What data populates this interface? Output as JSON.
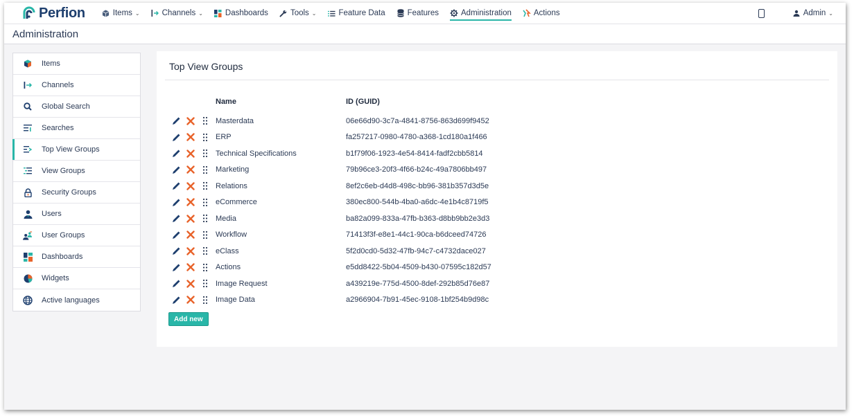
{
  "app": {
    "brand": "Perfion",
    "title": "Administration"
  },
  "nav": {
    "items": [
      {
        "label": "Items",
        "icon": "cube-icon",
        "dropdown": true
      },
      {
        "label": "Channels",
        "icon": "channel-icon",
        "dropdown": true
      },
      {
        "label": "Dashboards",
        "icon": "dashboard-icon",
        "dropdown": false
      },
      {
        "label": "Tools",
        "icon": "wrench-icon",
        "dropdown": true
      },
      {
        "label": "Feature Data",
        "icon": "list-icon",
        "dropdown": false
      },
      {
        "label": "Features",
        "icon": "database-icon",
        "dropdown": false
      },
      {
        "label": "Administration",
        "icon": "gear-icon",
        "dropdown": false,
        "active": true
      },
      {
        "label": "Actions",
        "icon": "actions-icon",
        "dropdown": false
      }
    ],
    "user_label": "Admin"
  },
  "sidebar": {
    "items": [
      {
        "label": "Items",
        "icon": "cube-icon"
      },
      {
        "label": "Channels",
        "icon": "channel-icon"
      },
      {
        "label": "Global Search",
        "icon": "search-icon"
      },
      {
        "label": "Searches",
        "icon": "searches-icon"
      },
      {
        "label": "Top View Groups",
        "icon": "top-view-groups-icon",
        "active": true
      },
      {
        "label": "View Groups",
        "icon": "view-groups-icon"
      },
      {
        "label": "Security Groups",
        "icon": "lock-icon"
      },
      {
        "label": "Users",
        "icon": "user-icon"
      },
      {
        "label": "User Groups",
        "icon": "user-groups-icon"
      },
      {
        "label": "Dashboards",
        "icon": "dashboard-icon"
      },
      {
        "label": "Widgets",
        "icon": "pie-icon"
      },
      {
        "label": "Active languages",
        "icon": "globe-icon"
      }
    ]
  },
  "main": {
    "title": "Top View Groups",
    "columns": {
      "name": "Name",
      "id": "ID (GUID)"
    },
    "rows": [
      {
        "name": "Masterdata",
        "id": "06e66d90-3c7a-4841-8756-863d699f9452"
      },
      {
        "name": "ERP",
        "id": "fa257217-0980-4780-a368-1cd180a1f466"
      },
      {
        "name": "Technical Specifications",
        "id": "b1f79f06-1923-4e54-8414-fadf2cbb5814"
      },
      {
        "name": "Marketing",
        "id": "79b96ce3-20f3-4f66-b24c-49a7806bb497"
      },
      {
        "name": "Relations",
        "id": "8ef2c6eb-d4d8-498c-bb96-381b357d3d5e"
      },
      {
        "name": "eCommerce",
        "id": "380ec800-544b-4ba0-a6dc-4e1b4c8719f5"
      },
      {
        "name": "Media",
        "id": "ba82a099-833a-47fb-b363-d8bb9bb2e3d3"
      },
      {
        "name": "Workflow",
        "id": "71413f3f-e8e1-44c1-90ca-b6dceed74726"
      },
      {
        "name": "eClass",
        "id": "5f2d0cd0-5d32-47fb-94c7-c4732dace027"
      },
      {
        "name": "Actions",
        "id": "e5dd8422-5b04-4509-b430-07595c182d57"
      },
      {
        "name": "Image Request",
        "id": "a439219e-775d-4500-8def-292b85d76e87"
      },
      {
        "name": "Image Data",
        "id": "a2966904-7b91-45ec-9108-1bf254b9d98c"
      }
    ],
    "add_button": "Add new"
  },
  "colors": {
    "accent": "#29b6a8",
    "brand": "#1e3f6e",
    "delete": "#e8632a",
    "edit": "#1e3f6e"
  }
}
